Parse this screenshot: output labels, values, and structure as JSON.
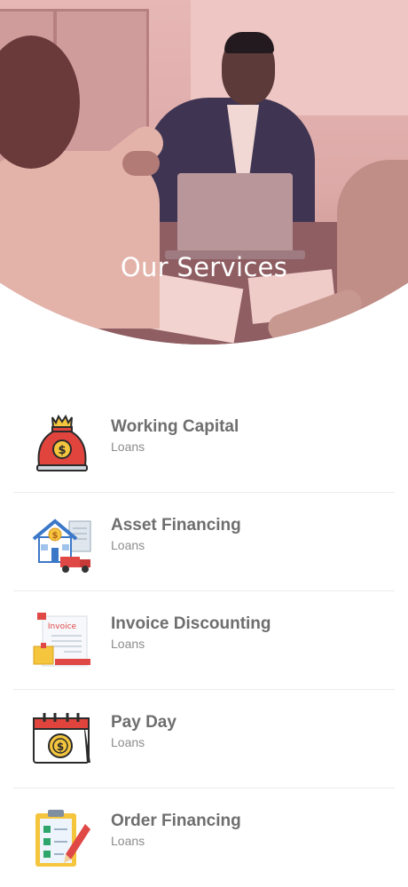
{
  "header": {
    "title": "Our Services"
  },
  "services": [
    {
      "title": "Working Capital",
      "subtitle": "Loans",
      "icon": "money-bag-icon"
    },
    {
      "title": "Asset Financing",
      "subtitle": "Loans",
      "icon": "house-truck-icon"
    },
    {
      "title": "Invoice Discounting",
      "subtitle": "Loans",
      "icon": "invoice-icon",
      "icon_text": "Invoice"
    },
    {
      "title": "Pay Day",
      "subtitle": "Loans",
      "icon": "calendar-coin-icon"
    },
    {
      "title": "Order Financing",
      "subtitle": "Loans",
      "icon": "clipboard-checklist-icon"
    }
  ],
  "colors": {
    "hero_tint": "#d98d8f",
    "title_text": "#6e6e6e",
    "subtitle_text": "#8c8c8c"
  }
}
